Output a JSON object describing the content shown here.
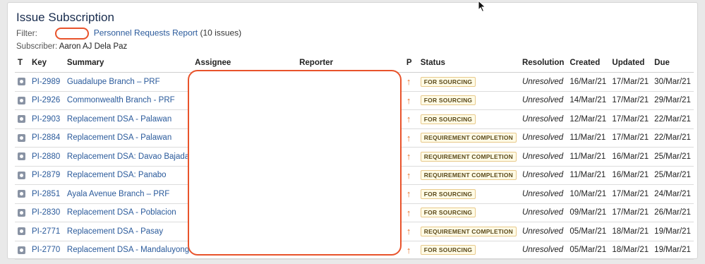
{
  "title": "Issue Subscription",
  "filter": {
    "label": "Filter:",
    "name": "Personnel Requests Report",
    "count": "(10 issues)"
  },
  "subscriber": {
    "label": "Subscriber:",
    "name": "Aaron AJ Dela Paz"
  },
  "columns": {
    "t": "T",
    "key": "Key",
    "summary": "Summary",
    "assignee": "Assignee",
    "reporter": "Reporter",
    "p": "P",
    "status": "Status",
    "resolution": "Resolution",
    "created": "Created",
    "updated": "Updated",
    "due": "Due"
  },
  "issues": [
    {
      "key": "PI-2989",
      "summary": "Guadalupe Branch – PRF",
      "status": "FOR SOURCING",
      "resolution": "Unresolved",
      "created": "16/Mar/21",
      "updated": "17/Mar/21",
      "due": "30/Mar/21"
    },
    {
      "key": "PI-2926",
      "summary": "Commonwealth Branch - PRF",
      "status": "FOR SOURCING",
      "resolution": "Unresolved",
      "created": "14/Mar/21",
      "updated": "17/Mar/21",
      "due": "29/Mar/21"
    },
    {
      "key": "PI-2903",
      "summary": "Replacement DSA - Palawan",
      "status": "FOR SOURCING",
      "resolution": "Unresolved",
      "created": "12/Mar/21",
      "updated": "17/Mar/21",
      "due": "22/Mar/21"
    },
    {
      "key": "PI-2884",
      "summary": "Replacement DSA - Palawan",
      "status": "REQUIREMENT COMPLETION",
      "resolution": "Unresolved",
      "created": "11/Mar/21",
      "updated": "17/Mar/21",
      "due": "22/Mar/21"
    },
    {
      "key": "PI-2880",
      "summary": "Replacement DSA: Davao Bajada",
      "status": "REQUIREMENT COMPLETION",
      "resolution": "Unresolved",
      "created": "11/Mar/21",
      "updated": "16/Mar/21",
      "due": "25/Mar/21"
    },
    {
      "key": "PI-2879",
      "summary": "Replacement DSA: Panabo",
      "status": "REQUIREMENT COMPLETION",
      "resolution": "Unresolved",
      "created": "11/Mar/21",
      "updated": "16/Mar/21",
      "due": "25/Mar/21"
    },
    {
      "key": "PI-2851",
      "summary": "Ayala Avenue Branch – PRF",
      "status": "FOR SOURCING",
      "resolution": "Unresolved",
      "created": "10/Mar/21",
      "updated": "17/Mar/21",
      "due": "24/Mar/21"
    },
    {
      "key": "PI-2830",
      "summary": "Replacement DSA - Poblacion",
      "status": "FOR SOURCING",
      "resolution": "Unresolved",
      "created": "09/Mar/21",
      "updated": "17/Mar/21",
      "due": "26/Mar/21"
    },
    {
      "key": "PI-2771",
      "summary": "Replacement DSA - Pasay",
      "status": "REQUIREMENT COMPLETION",
      "resolution": "Unresolved",
      "created": "05/Mar/21",
      "updated": "18/Mar/21",
      "due": "19/Mar/21"
    },
    {
      "key": "PI-2770",
      "summary": "Replacement DSA - Mandaluyong",
      "status": "FOR SOURCING",
      "resolution": "Unresolved",
      "created": "05/Mar/21",
      "updated": "18/Mar/21",
      "due": "19/Mar/21"
    }
  ],
  "icons": {
    "type": "issue-type-icon",
    "priority": "priority-major-arrow-icon",
    "cursor": "mouse-pointer-icon"
  },
  "colors": {
    "link": "#2a5a9b",
    "priority": "#e8752b",
    "redaction": "#e8532b",
    "badge_bg": "#fffbe6",
    "badge_border": "#e8c98a"
  }
}
